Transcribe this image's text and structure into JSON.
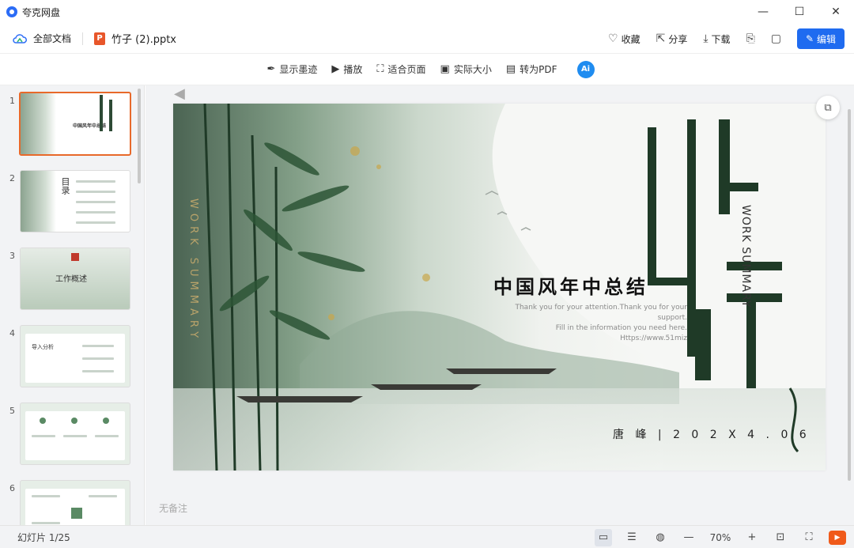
{
  "window": {
    "app_name": "夸克网盘",
    "controls": {
      "minimize": "—",
      "maximize": "☐",
      "close": "✕"
    }
  },
  "docbar": {
    "all_docs_label": "全部文档",
    "file_icon_letter": "P",
    "file_name": "竹子 (2).pptx",
    "actions": {
      "favorite": "收藏",
      "share": "分享",
      "download": "下载",
      "edit": "编辑"
    }
  },
  "toolbar": {
    "show_ink": "显示墨迹",
    "play": "播放",
    "fit_page": "适合页面",
    "actual_size": "实际大小",
    "to_pdf": "转为PDF",
    "ai_label": "Ai"
  },
  "thumbnails": [
    {
      "num": "1",
      "title": "中国风年中总结",
      "selected": true
    },
    {
      "num": "2",
      "title": "目录",
      "selected": false
    },
    {
      "num": "3",
      "title": "工作概述",
      "selected": false
    },
    {
      "num": "4",
      "title": "导入分析",
      "selected": false
    },
    {
      "num": "5",
      "title": "",
      "selected": false
    },
    {
      "num": "6",
      "title": "",
      "selected": false
    }
  ],
  "slide": {
    "big_chars": "出行",
    "title": "中国风年中总结",
    "subtitle_lines": [
      "Thank you for your attention.Thank you for your support.",
      "Fill in the information you need here.",
      "Https://www.51miz"
    ],
    "work_summary_vertical": "WORK SUMMARY",
    "work_summary_right": "WORK SUMMARY",
    "author_date": "唐 峰 | 2 0 2 X 4 . 0 6"
  },
  "notes_placeholder": "无备注",
  "statusbar": {
    "slide_counter": "幻灯片 1/25",
    "zoom": "70%"
  },
  "colors": {
    "accent_blue": "#1f6bf0",
    "ppt_orange": "#e8562a",
    "selection_orange": "#e8692a",
    "play_orange": "#f05a1a"
  }
}
